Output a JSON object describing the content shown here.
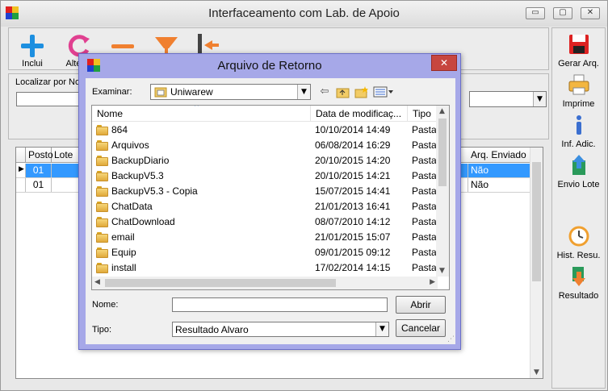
{
  "main_window": {
    "title": "Interfaceamento com Lab. de Apoio",
    "controls": {
      "minimize": "▭",
      "restore": "▢",
      "close": "✕"
    }
  },
  "toolbar": {
    "inclui_label": "Inclui",
    "altera_label": "Alte"
  },
  "filter": {
    "label": "Localizar por Nom",
    "value": ""
  },
  "grid": {
    "columns": [
      "Posto",
      "Lote",
      "Arq. Enviado"
    ],
    "rows": [
      {
        "posto": "01",
        "lote": "",
        "arq_enviado": "Não",
        "selected": true
      },
      {
        "posto": "01",
        "lote": "",
        "arq_enviado": "Não",
        "selected": false
      }
    ]
  },
  "right_panel": {
    "gerar_arq": "Gerar Arq.",
    "imprime": "Imprime",
    "inf_adic": "Inf. Adic.",
    "envio_lote": "Envio Lote",
    "hist_resu": "Hist. Resu.",
    "resultado": "Resultado"
  },
  "dialog": {
    "title": "Arquivo de Retorno",
    "close": "✕",
    "look_in_label": "Examinar:",
    "look_in_value": "Uniwarew",
    "columns": {
      "name": "Nome",
      "date": "Data de modificaç...",
      "type": "Tipo"
    },
    "files": [
      {
        "name": "864",
        "date": "10/10/2014 14:49",
        "type": "Pasta"
      },
      {
        "name": "Arquivos",
        "date": "06/08/2014 16:29",
        "type": "Pasta"
      },
      {
        "name": "BackupDiario",
        "date": "20/10/2015 14:20",
        "type": "Pasta"
      },
      {
        "name": "BackupV5.3",
        "date": "20/10/2015 14:21",
        "type": "Pasta"
      },
      {
        "name": "BackupV5.3 - Copia",
        "date": "15/07/2015 14:41",
        "type": "Pasta"
      },
      {
        "name": "ChatData",
        "date": "21/01/2013 16:41",
        "type": "Pasta"
      },
      {
        "name": "ChatDownload",
        "date": "08/07/2010 14:12",
        "type": "Pasta"
      },
      {
        "name": "email",
        "date": "21/01/2015 15:07",
        "type": "Pasta"
      },
      {
        "name": "Equip",
        "date": "09/01/2015 09:12",
        "type": "Pasta"
      },
      {
        "name": "install",
        "date": "17/02/2014 14:15",
        "type": "Pasta"
      }
    ],
    "name_label": "Nome:",
    "name_value": "",
    "type_label": "Tipo:",
    "type_value": "Resultado Alvaro",
    "open_button": "Abrir",
    "cancel_button": "Cancelar"
  },
  "colors": {
    "dialog_frame": "#a6a8e8",
    "close_red": "#c7463f",
    "selection_blue": "#3399ff"
  }
}
